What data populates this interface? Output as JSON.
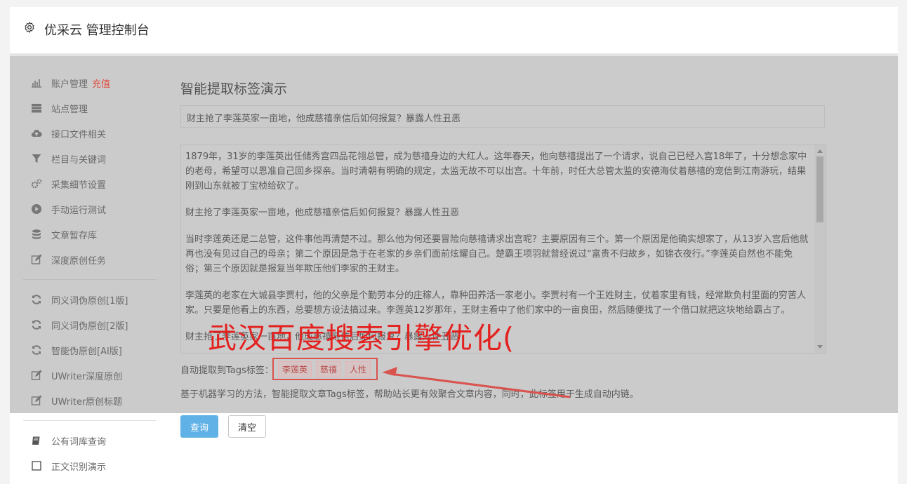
{
  "app": {
    "title": "优采云 管理控制台"
  },
  "sidebar": {
    "items": [
      {
        "label": "账户管理",
        "extra": "充值",
        "icon": "bar-chart-icon"
      },
      {
        "label": "站点管理",
        "icon": "server-icon"
      },
      {
        "label": "接口文件相关",
        "icon": "cloud-upload-icon"
      },
      {
        "label": "栏目与关键词",
        "icon": "filter-icon"
      },
      {
        "label": "采集细节设置",
        "icon": "gears-icon"
      },
      {
        "label": "手动运行测试",
        "icon": "play-circle-icon"
      },
      {
        "label": "文章暂存库",
        "icon": "database-icon"
      },
      {
        "label": "深度原创任务",
        "icon": "edit-icon"
      },
      {
        "label": "同义词伪原创[1版]",
        "icon": "refresh-icon"
      },
      {
        "label": "同义词伪原创[2版]",
        "icon": "refresh-icon"
      },
      {
        "label": "智能伪原创[AI版]",
        "icon": "refresh-icon"
      },
      {
        "label": "UWriter深度原创",
        "icon": "edit-icon"
      },
      {
        "label": "UWriter原创标题",
        "icon": "edit-icon"
      },
      {
        "label": "公有词库查询",
        "icon": "book-icon"
      },
      {
        "label": "正文识别演示",
        "icon": "square-icon"
      }
    ]
  },
  "main": {
    "heading": "智能提取标签演示",
    "title_value": "财主抢了李莲英家一亩地，他成慈禧亲信后如何报复？暴露人性丑恶",
    "paragraphs": [
      "1879年，31岁的李莲英出任储秀宫四品花翎总管，成为慈禧身边的大红人。这年春天，他向慈禧提出了一个请求，说自己已经入宫18年了，十分想念家中的老母，希望可以恩准自己回乡探亲。当时清朝有明确的规定，太监无故不可以出宫。十年前，时任大总管太监的安德海仗着慈禧的宠信到江南游玩，结果刚到山东就被丁宝桢给砍了。",
      "财主抢了李莲英家一亩地，他成慈禧亲信后如何报复？暴露人性丑恶",
      "当时李莲英还是二总管，这件事他再清楚不过。那么他为何还要冒险向慈禧请求出宫呢？主要原因有三个。第一个原因是他确实想家了，从13岁入宫后他就再也没有见过自己的母亲；第二个原因是急于在老家的乡亲们面前炫耀自己。楚霸王项羽就曾经说过“富贵不归故乡，如锦衣夜行。”李莲英自然也不能免俗；第三个原因就是报复当年欺压他们李家的王财主。",
      "李莲英的老家在大城县李贾村，他的父亲是个勤劳本分的庄稼人，靠种田养活一家老小。李贾村有一个王姓财主，仗着家里有钱，经常欺负村里面的穷苦人家。只要是他看上的东西，总要想方设法搞过来。李莲英12岁那年，王财主看中了他们家中的一亩良田，然后随便找了一个借口就把这块地给霸占了。",
      "财主抢了李莲英家一亩地，他成慈禧亲信后如何报复？暴露人性丑恶"
    ],
    "tags_label": "自动提取到Tags标签：",
    "tags": [
      "李莲英",
      "慈禧",
      "人性"
    ],
    "description": "基于机器学习的方法，智能提取文章Tags标签，帮助站长更有效聚合文章内容，同时，此标签用于生成自动内链。",
    "query_button": "查询",
    "clear_button": "清空"
  },
  "watermark": "武汉百度搜索引擎优化(",
  "colors": {
    "accent": "#e04a3b",
    "primary_button": "#5fb1e6",
    "overlay": "#cbcbcb",
    "annotation": "#d9534f"
  }
}
